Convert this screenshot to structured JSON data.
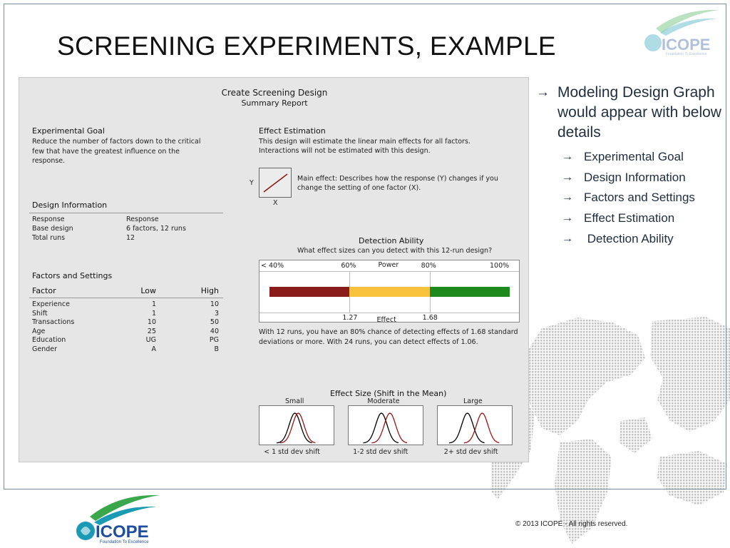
{
  "slide": {
    "title": "SCREENING EXPERIMENTS, EXAMPLE",
    "copyright": "©  2013 ICOPE - All rights reserved.",
    "logo": {
      "name": "ICOPE",
      "tagline": "Foundation To Excellence"
    },
    "colors": {
      "logo_blue": "#1f4e9c",
      "logo_green": "#3aa84a",
      "logo_teal": "#1a9ab5",
      "frame": "#7a8fa6"
    }
  },
  "report": {
    "title": "Create Screening Design",
    "subtitle": "Summary Report",
    "experimental_goal": {
      "heading": "Experimental Goal",
      "text": "Reduce the number of factors down to the critical few that have the greatest influence on the response."
    },
    "design_information": {
      "heading": "Design Information",
      "rows": [
        {
          "label": "Response",
          "value": "Response"
        },
        {
          "label": "Base design",
          "value": "6 factors, 12 runs"
        },
        {
          "label": "Total runs",
          "value": "12"
        }
      ]
    },
    "factors": {
      "heading": "Factors and Settings",
      "columns": [
        "Factor",
        "Low",
        "High"
      ],
      "rows": [
        {
          "factor": "Experience",
          "low": "1",
          "high": "10"
        },
        {
          "factor": "Shift",
          "low": "1",
          "high": "3"
        },
        {
          "factor": "Transactions",
          "low": "10",
          "high": "50"
        },
        {
          "factor": "Age",
          "low": "25",
          "high": "40"
        },
        {
          "factor": "Education",
          "low": "UG",
          "high": "PG"
        },
        {
          "factor": "Gender",
          "low": "A",
          "high": "B"
        }
      ]
    },
    "effect_estimation": {
      "heading": "Effect Estimation",
      "text_line1": "This design will estimate the linear main effects for all factors.",
      "text_line2": "Interactions will not be estimated with this design.",
      "main_effect_line1": "Main effect: Describes how the response (Y) changes if you",
      "main_effect_line2": "change the setting of one factor (X).",
      "y_label": "Y",
      "x_label": "X"
    },
    "detection": {
      "heading": "Detection Ability",
      "question": "What effect sizes can you detect with this 12-run design?",
      "power_label": "Power",
      "effect_label": "Effect",
      "power_ticks": [
        "< 40%",
        "60%",
        "80%",
        "100%"
      ],
      "effect_ticks": [
        "1.27",
        "1.68"
      ],
      "segments": [
        {
          "from_power": 0.4,
          "to_power": 0.6,
          "color": "#8b1c1c"
        },
        {
          "from_power": 0.6,
          "to_power": 0.8,
          "color": "#f9c23c"
        },
        {
          "from_power": 0.8,
          "to_power": 1.0,
          "color": "#1e8a1e"
        }
      ],
      "note_line1": "With 12 runs, you have an 80% chance of detecting effects of 1.68 standard",
      "note_line2": "deviations or more. With 24 runs, you can detect effects of 1.06."
    },
    "effect_size": {
      "heading": "Effect Size (Shift in the Mean)",
      "panels": [
        {
          "label": "Small",
          "caption": "< 1 std dev shift",
          "shift": 0.6
        },
        {
          "label": "Moderate",
          "caption": "1-2 std dev shift",
          "shift": 1.5
        },
        {
          "label": "Large",
          "caption": "2+ std dev shift",
          "shift": 2.6
        }
      ],
      "colors": {
        "base": "#000000",
        "shifted": "#a01414"
      }
    }
  },
  "bullets": {
    "main": "Modeling Design Graph would appear with below details",
    "items": [
      "Experimental Goal",
      "Design Information",
      "Factors and Settings",
      "Effect Estimation",
      " Detection Ability"
    ]
  }
}
